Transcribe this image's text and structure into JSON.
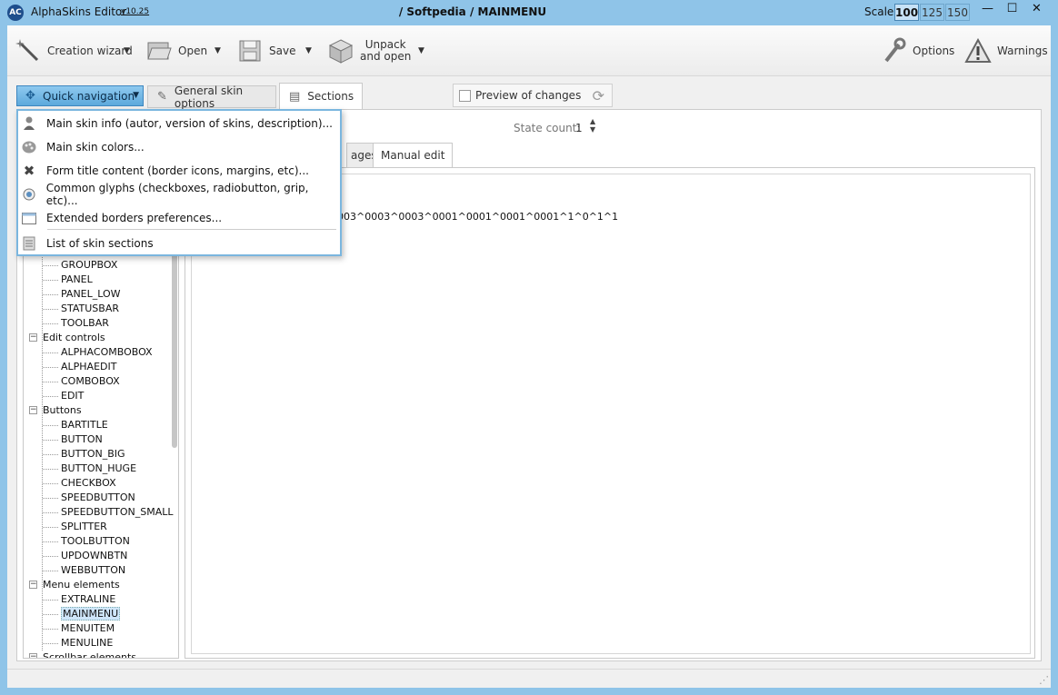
{
  "titlebar": {
    "app_name": "AlphaSkins Editor",
    "app_logo_text": "AC",
    "version": "v10.25",
    "document": "/ Softpedia / MAINMENU",
    "scale_label": "Scale:",
    "scale_options": [
      "100",
      "125",
      "150"
    ],
    "scale_selected": "100",
    "minimize": "—",
    "maximize": "☐",
    "close": "✕"
  },
  "toolbar": {
    "creation_wizard": "Creation wizard",
    "open": "Open",
    "save": "Save",
    "unpack_line1": "Unpack",
    "unpack_line2": "and open",
    "options": "Options",
    "warnings": "Warnings"
  },
  "tabs": {
    "quick_navigation": "Quick navigation",
    "general": "General  skin options",
    "sections": "Sections",
    "preview": "Preview of changes"
  },
  "state": {
    "label": "State count:",
    "value": "1"
  },
  "subtabs": {
    "images": "ages",
    "manual_edit": "Manual edit"
  },
  "editor": {
    "text": "003^0003^0003^0001^0001^0001^0001^1^0^1^1"
  },
  "quick_nav_menu": [
    {
      "label": "Main skin info (autor, version of skins, description)...",
      "icon": "user-info-icon"
    },
    {
      "label": "Main skin colors...",
      "icon": "palette-icon"
    },
    {
      "label": "Form title content (border icons, margins, etc)...",
      "icon": "close-x-icon"
    },
    {
      "label": "Common glyphs (checkboxes, radiobutton, grip, etc)...",
      "icon": "radio-glyph-icon"
    },
    {
      "label": "Extended borders preferences...",
      "icon": "window-border-icon"
    },
    {
      "label": "List of skin sections",
      "icon": "list-sections-icon"
    }
  ],
  "tree": {
    "items": [
      {
        "label": "GROUPBOX",
        "level": 1
      },
      {
        "label": "PANEL",
        "level": 1
      },
      {
        "label": "PANEL_LOW",
        "level": 1
      },
      {
        "label": "STATUSBAR",
        "level": 1
      },
      {
        "label": "TOOLBAR",
        "level": 1
      },
      {
        "label": "Edit controls",
        "level": 0
      },
      {
        "label": "ALPHACOMBOBOX",
        "level": 1
      },
      {
        "label": "ALPHAEDIT",
        "level": 1
      },
      {
        "label": "COMBOBOX",
        "level": 1
      },
      {
        "label": "EDIT",
        "level": 1
      },
      {
        "label": "Buttons",
        "level": 0
      },
      {
        "label": "BARTITLE",
        "level": 1
      },
      {
        "label": "BUTTON",
        "level": 1
      },
      {
        "label": "BUTTON_BIG",
        "level": 1
      },
      {
        "label": "BUTTON_HUGE",
        "level": 1
      },
      {
        "label": "CHECKBOX",
        "level": 1
      },
      {
        "label": "SPEEDBUTTON",
        "level": 1
      },
      {
        "label": "SPEEDBUTTON_SMALL",
        "level": 1
      },
      {
        "label": "SPLITTER",
        "level": 1
      },
      {
        "label": "TOOLBUTTON",
        "level": 1
      },
      {
        "label": "UPDOWNBTN",
        "level": 1
      },
      {
        "label": "WEBBUTTON",
        "level": 1
      },
      {
        "label": "Menu elements",
        "level": 0
      },
      {
        "label": "EXTRALINE",
        "level": 1
      },
      {
        "label": "MAINMENU",
        "level": 1,
        "selected": true
      },
      {
        "label": "MENUITEM",
        "level": 1
      },
      {
        "label": "MENULINE",
        "level": 1
      },
      {
        "label": "Scrollbar elements",
        "level": 0
      }
    ]
  },
  "colors": {
    "title_bar": "#8fc4e8",
    "accent": "#5da9dc",
    "selection": "#cfe6fa"
  }
}
